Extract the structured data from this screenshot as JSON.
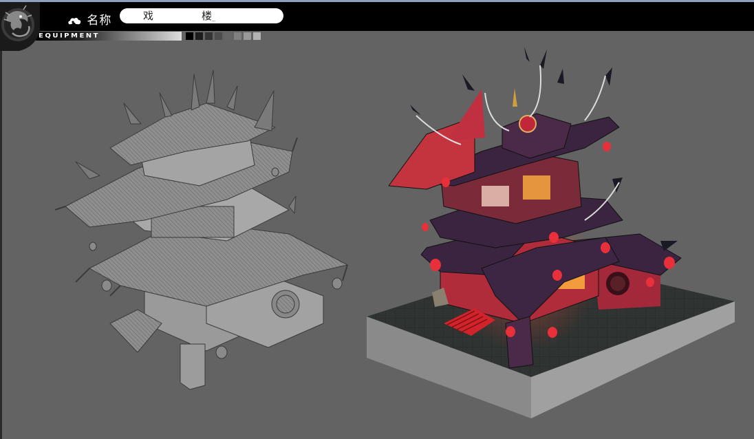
{
  "header": {
    "name_label": "名称",
    "name_value_chars": [
      "戏",
      "楼"
    ],
    "equipment_label": "EQUIPMENT"
  },
  "swatches": [
    "#000000",
    "#1c1c1c",
    "#343434",
    "#4d4d4d",
    "#666666",
    "#808080",
    "#999999",
    "#b3b3b3"
  ],
  "icons": {
    "logo": "dragon-emblem-icon",
    "name_marker": "cloud-icon"
  },
  "artwork": {
    "left": "line-art-sketch",
    "right": "colored-render"
  },
  "colors": {
    "background": "#636363",
    "header": "#000000",
    "accent_red": "#c0282e",
    "roof_purple": "#3a2440"
  }
}
